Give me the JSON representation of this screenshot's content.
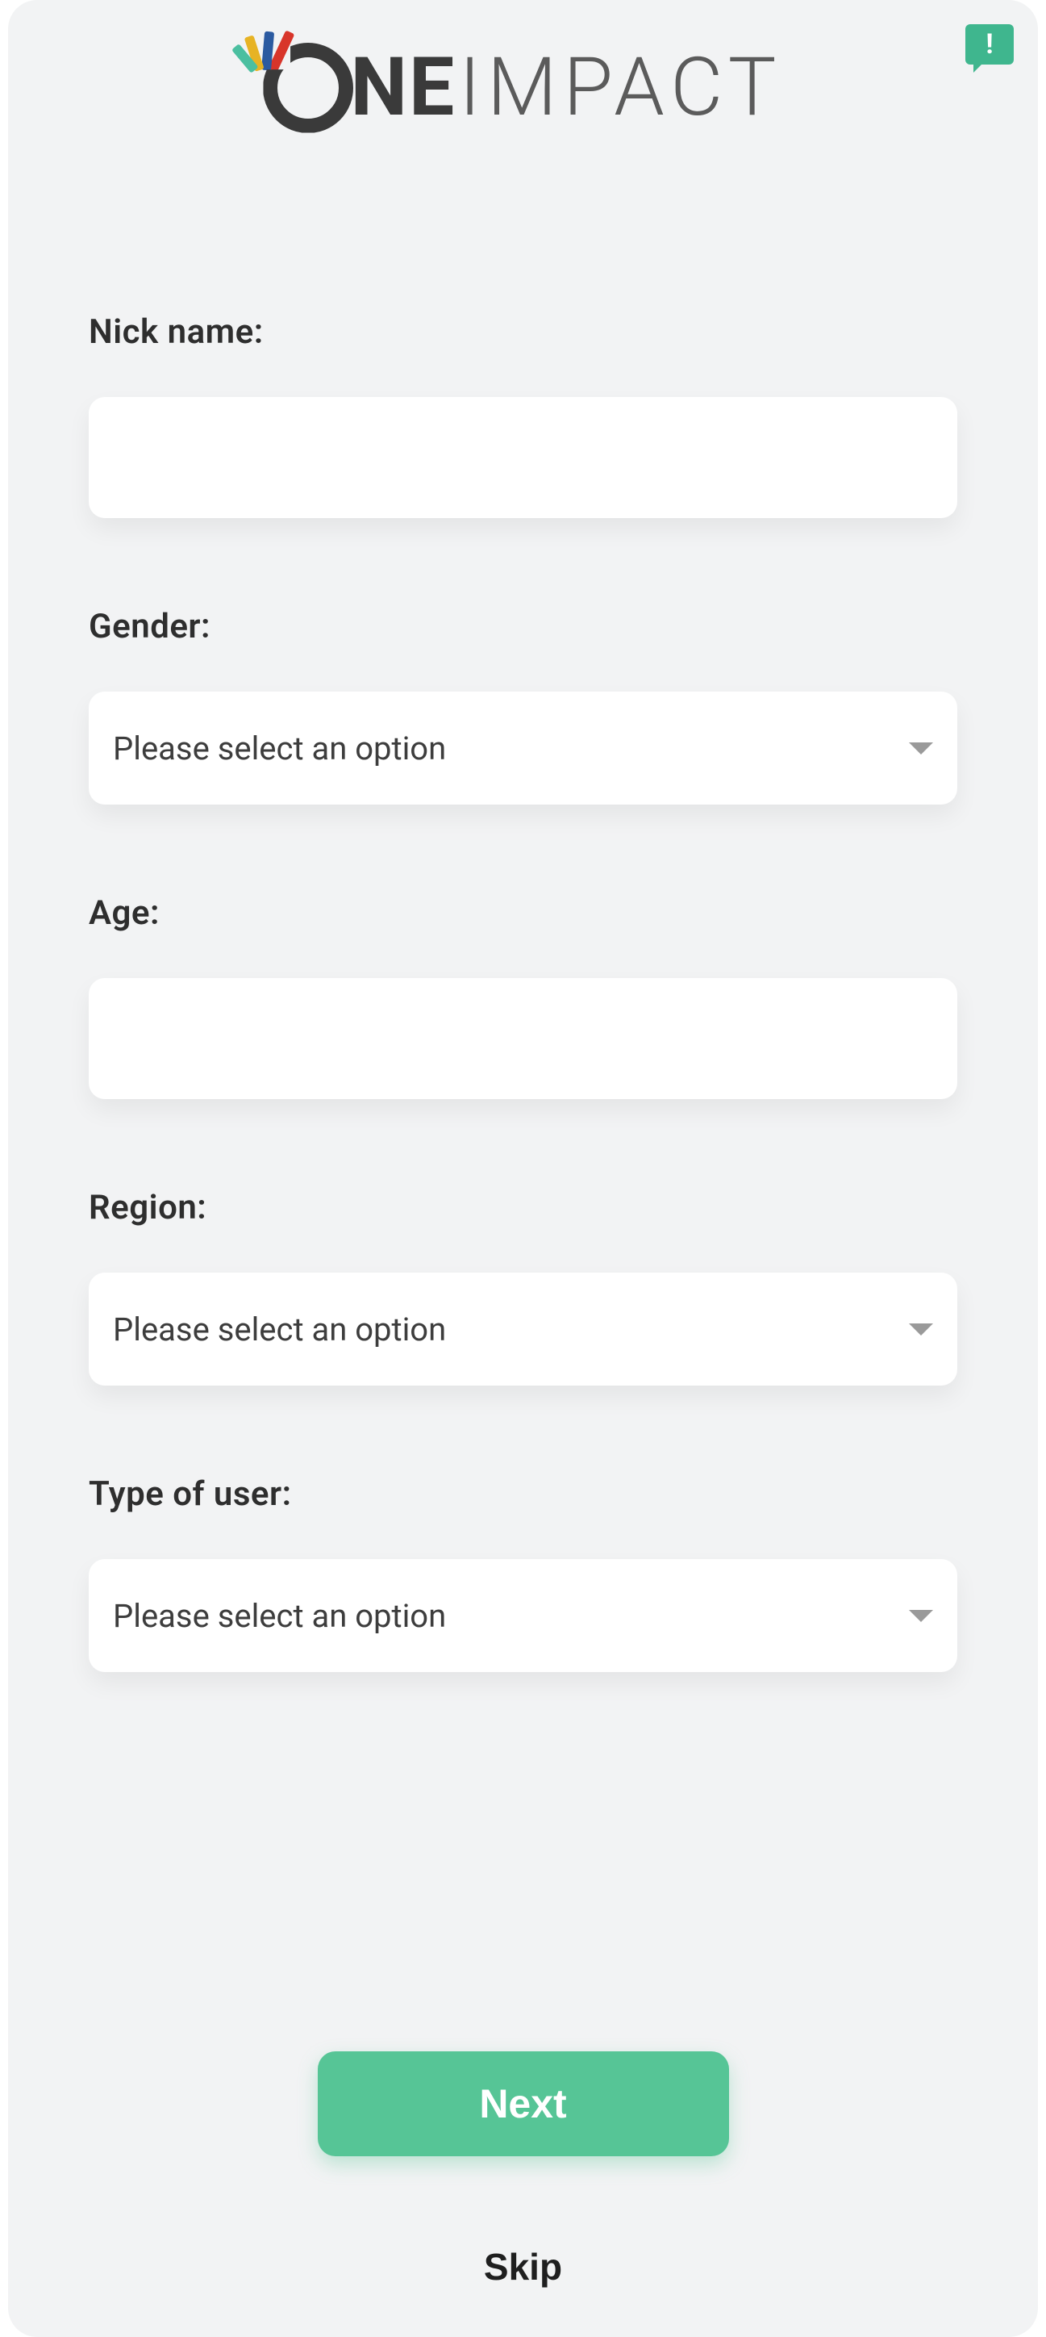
{
  "brand": {
    "one": "NE",
    "impact": "IMPACT"
  },
  "feedback_icon_glyph": "!",
  "form": {
    "nickname": {
      "label": "Nick name:",
      "value": ""
    },
    "gender": {
      "label": "Gender:",
      "placeholder": "Please select an option"
    },
    "age": {
      "label": "Age:",
      "value": ""
    },
    "region": {
      "label": "Region:",
      "placeholder": "Please select an option"
    },
    "usertype": {
      "label": "Type of user:",
      "placeholder": "Please select an option"
    }
  },
  "actions": {
    "next": "Next",
    "skip": "Skip"
  },
  "colors": {
    "accent": "#56c596",
    "background": "#f2f3f4",
    "text": "#2e2e2e"
  }
}
